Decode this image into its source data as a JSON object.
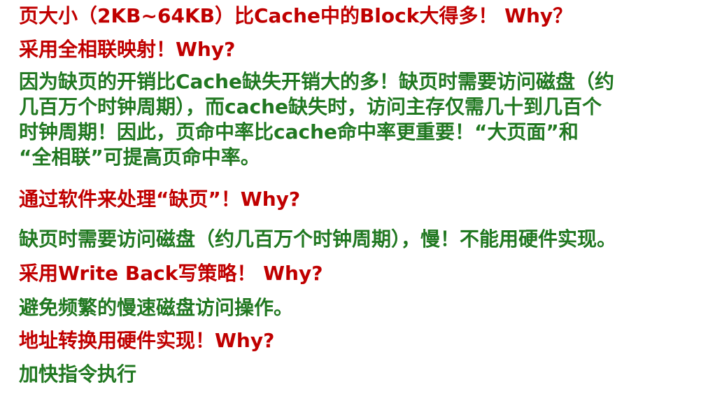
{
  "slide": {
    "q1": "页大小（2KB~64KB）比Cache中的Block大得多！ Why？",
    "q2": "采用全相联映射！Why?",
    "a2": [
      "因为缺页的开销比Cache缺失开销大的多！缺页时需要访问磁盘（约",
      "几百万个时钟周期），而cache缺失时，访问主存仅需几十到几百个",
      "时钟周期！因此，页命中率比cache命中率更重要！“大页面”和",
      "“全相联”可提高页命中率。"
    ],
    "q3": "通过软件来处理“缺页”！Why?",
    "a3": "缺页时需要访问磁盘（约几百万个时钟周期），慢！不能用硬件实现。",
    "q4": "采用Write Back写策略！ Why?",
    "a4": "避免频繁的慢速磁盘访问操作。",
    "q5": "地址转换用硬件实现！Why?",
    "a5": "加快指令执行"
  },
  "colors": {
    "question": "#c00000",
    "answer": "#217821"
  }
}
